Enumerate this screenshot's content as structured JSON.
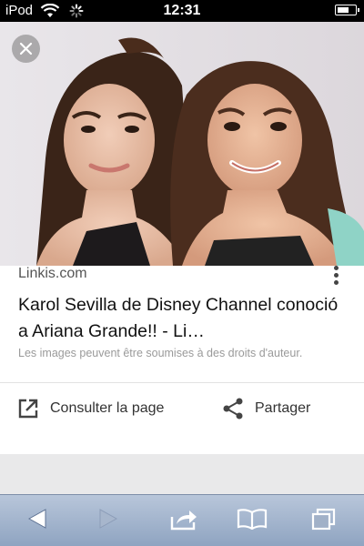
{
  "status_bar": {
    "carrier": "iPod",
    "time": "12:31",
    "battery_level": 0.7
  },
  "photo": {
    "description_icon": "photo-image"
  },
  "result": {
    "source": "Linkis.com",
    "title": "Karol Sevilla de Disney Channel conoció a Ariana Grande!! - Li…",
    "copyright_notice": "Les images peuvent être soumises à des droits d'auteur."
  },
  "actions": {
    "visit_label": "Consulter la page",
    "share_label": "Partager"
  },
  "colors": {
    "accent": "#1a73e8",
    "toolbar": "#a6b6cd",
    "text": "#111111"
  },
  "icons": {
    "close": "close-icon",
    "more": "more-vert-icon",
    "open": "open-in-new-icon",
    "share": "share-icon",
    "back": "back-arrow-icon",
    "forward": "forward-arrow-icon",
    "action": "share-out-icon",
    "bookmarks": "book-icon",
    "tabs": "tabs-icon"
  }
}
